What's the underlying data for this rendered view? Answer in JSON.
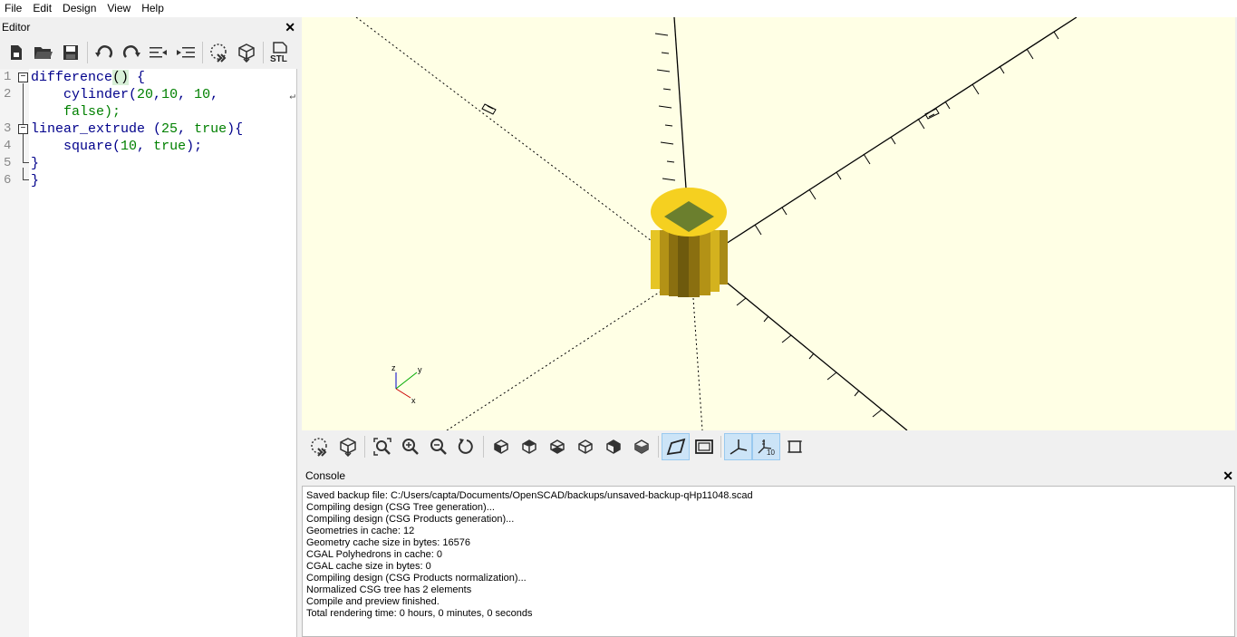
{
  "menu": [
    "File",
    "Edit",
    "Design",
    "View",
    "Help"
  ],
  "editor": {
    "title": "Editor",
    "close": "✕",
    "toolbar": [
      "new-icon",
      "open-icon",
      "save-icon",
      "undo-icon",
      "redo-icon",
      "unindent-icon",
      "indent-icon",
      "preview-icon",
      "render-icon",
      "export-stl-icon"
    ],
    "stl_label": "STL",
    "line_numbers": [
      "1",
      "2",
      "",
      "3",
      "4",
      "5",
      "6"
    ],
    "code": {
      "l1_kw": "difference",
      "l1_paren": "()",
      "l1_rest": " {",
      "l2_a": "    cylinder(",
      "l2_n1": "20",
      "l2_c1": ",",
      "l2_n2": "10",
      "l2_c2": ", ",
      "l2_n3": "10",
      "l2_c3": ",",
      "l2b": "    false);",
      "l3_kw": "linear_extrude",
      "l3_a": " (",
      "l3_n1": "25",
      "l3_c": ", ",
      "l3_n2": "true",
      "l3_b": "){",
      "l4_a": "    square(",
      "l4_n1": "10",
      "l4_c": ", ",
      "l4_n2": "true",
      "l4_b": ");",
      "l5": "}",
      "l6": "}"
    }
  },
  "viewport": {
    "background": "#ffffe5",
    "object_color": "#f5d020",
    "inner_color": "#6b7f2e",
    "axis_labels": [
      "z",
      "y",
      "x"
    ]
  },
  "view_toolbar": [
    "preview-icon",
    "render-icon",
    "view-all-icon",
    "zoom-in-icon",
    "zoom-out-icon",
    "reset-view-icon",
    "view-right-icon",
    "view-top-icon",
    "view-bottom-icon",
    "view-left-icon",
    "view-front-icon",
    "view-back-icon",
    "perspective-icon",
    "orthogonal-icon",
    "show-axes-icon",
    "show-scale-markers-icon",
    "show-edges-icon"
  ],
  "console": {
    "title": "Console",
    "close": "✕",
    "lines": [
      "Saved backup file: C:/Users/capta/Documents/OpenSCAD/backups/unsaved-backup-qHp11048.scad",
      "Compiling design (CSG Tree generation)...",
      "Compiling design (CSG Products generation)...",
      "Geometries in cache: 12",
      "Geometry cache size in bytes: 16576",
      "CGAL Polyhedrons in cache: 0",
      "CGAL cache size in bytes: 0",
      "Compiling design (CSG Products normalization)...",
      "Normalized CSG tree has 2 elements",
      "Compile and preview finished.",
      "Total rendering time: 0 hours, 0 minutes, 0 seconds"
    ]
  }
}
